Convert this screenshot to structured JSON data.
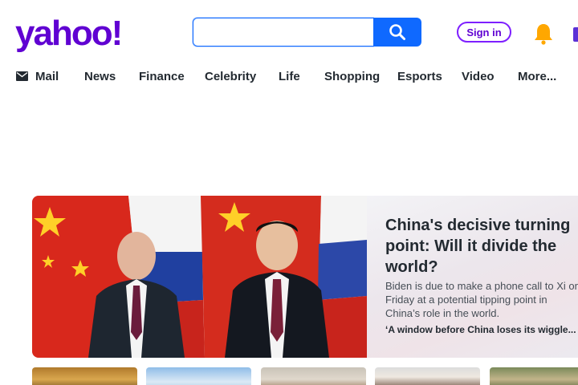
{
  "brand": {
    "logo_text": "yahoo!",
    "logo_color": "#6001d2"
  },
  "search": {
    "value": "",
    "placeholder": "",
    "button_icon": "search-icon",
    "accent": "#0f69ff"
  },
  "header": {
    "signin_label": "Sign in",
    "notification_icon": "bell-icon",
    "mail_icon": "mail-icon"
  },
  "nav": {
    "items": [
      {
        "label": "Mail",
        "icon": "envelope-icon"
      },
      {
        "label": "News"
      },
      {
        "label": "Finance"
      },
      {
        "label": "Celebrity"
      },
      {
        "label": "Life"
      },
      {
        "label": "Shopping"
      },
      {
        "label": "Esports"
      },
      {
        "label": "Video"
      },
      {
        "label": "More..."
      }
    ]
  },
  "hero": {
    "title": "China's decisive turning point: Will it divide the world?",
    "summary": "Biden is due to make a phone call to Xi on Friday at a potential tipping point in China’s role in the world.",
    "related": "‘A window before China loses its wiggle..."
  },
  "thumbnails": [
    {
      "name": "thumbnail-story-1"
    },
    {
      "name": "thumbnail-story-2"
    },
    {
      "name": "thumbnail-story-3"
    },
    {
      "name": "thumbnail-story-4"
    },
    {
      "name": "thumbnail-story-5"
    }
  ]
}
